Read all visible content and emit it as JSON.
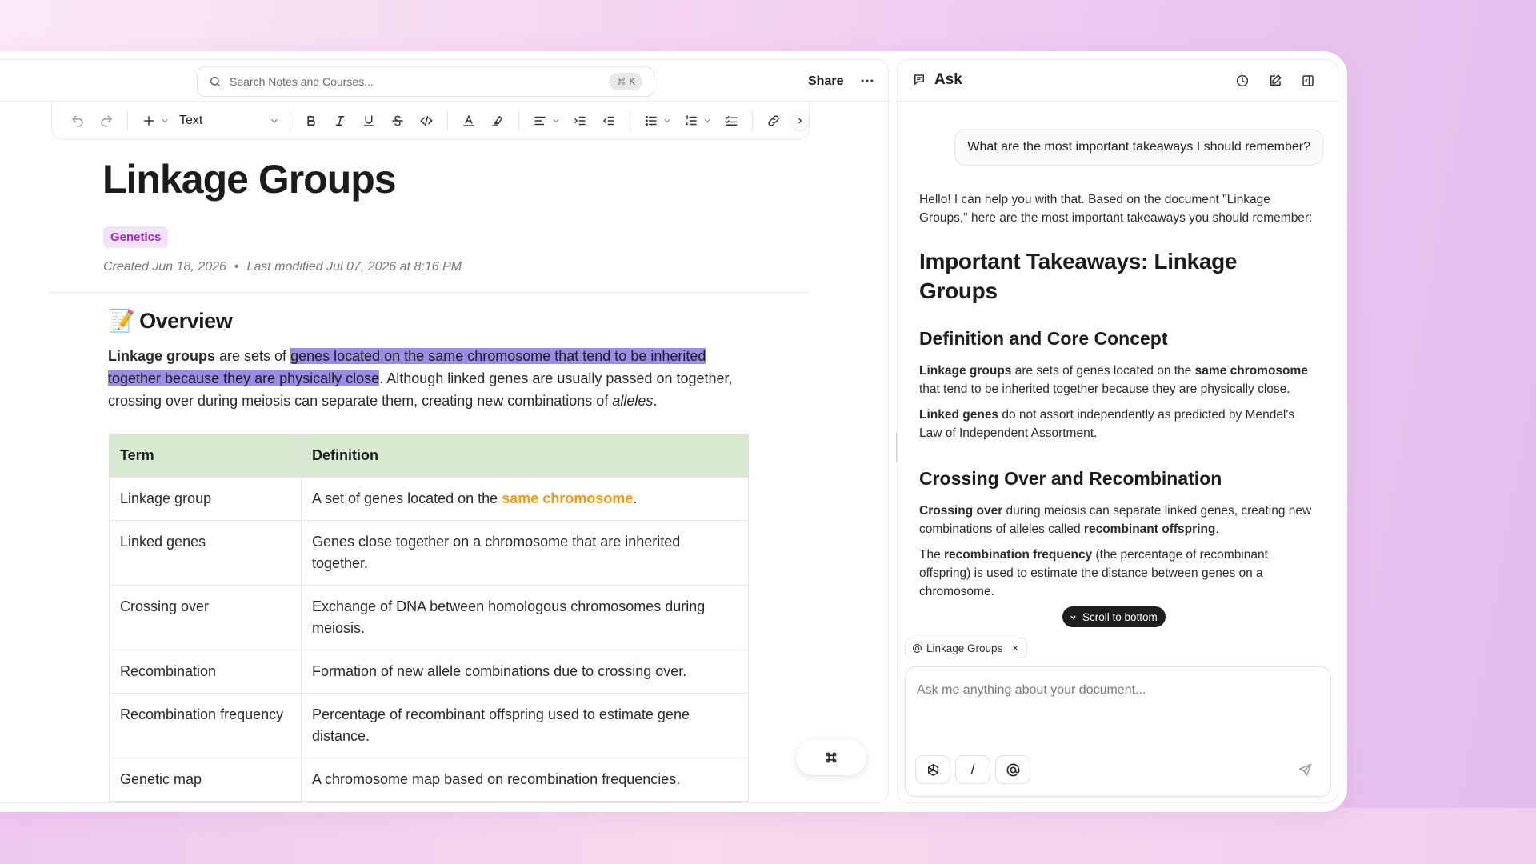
{
  "search": {
    "placeholder": "Search Notes and Courses...",
    "shortcut": "⌘ K"
  },
  "topbar": {
    "share_label": "Share"
  },
  "toolbar": {
    "text_style": "Text"
  },
  "document": {
    "title": "Linkage Groups",
    "tag": "Genetics",
    "created": "Created Jun 18, 2026",
    "separator": "•",
    "modified": "Last modified Jul 07, 2026 at 8:16 PM",
    "overview_emoji": "📝",
    "overview_heading": "Overview",
    "para": {
      "bold": "Linkage groups",
      "t1": " are sets of ",
      "highlight": "genes located on the same chromosome that tend to be inherited together because they are physically close",
      "t2": ". Although linked genes are usually passed on together, crossing over during meiosis can separate them, creating new combinations of ",
      "italic": "alleles",
      "t3": "."
    },
    "table": {
      "headers": [
        "Term",
        "Definition"
      ],
      "rows": [
        {
          "term": "Linkage group",
          "def_pre": "A set of genes located on the ",
          "def_em": "same chromosome",
          "def_post": "."
        },
        {
          "term": "Linked genes",
          "def": "Genes close together on a chromosome that are inherited together."
        },
        {
          "term": "Crossing over",
          "def": "Exchange of DNA between homologous chromosomes during meiosis."
        },
        {
          "term": "Recombination",
          "def": "Formation of new allele combinations due to crossing over."
        },
        {
          "term": "Recombination frequency",
          "def": "Percentage of recombinant offspring used to estimate gene distance."
        },
        {
          "term": "Genetic map",
          "def": "A chromosome map based on recombination frequencies."
        }
      ]
    }
  },
  "ask": {
    "title": "Ask",
    "user_message": "What are the most important takeaways I should remember?",
    "intro": "Hello! I can help you with that. Based on the document \"Linkage Groups,\" here are the most important takeaways you should remember:",
    "h1": "Important Takeaways: Linkage Groups",
    "section1_title": "Definition and Core Concept",
    "s1p1": {
      "b1": "Linkage groups",
      "t1": " are sets of genes located on the ",
      "b2": "same chromosome",
      "t2": " that tend to be inherited together because they are physically close."
    },
    "s1p2": {
      "b1": "Linked genes",
      "t1": " do not assort independently as predicted by Mendel's Law of Independent Assortment."
    },
    "section2_title": "Crossing Over and Recombination",
    "s2p1": {
      "b1": "Crossing over",
      "t1": " during meiosis can separate linked genes, creating new combinations of alleles called ",
      "b2": "recombinant offspring",
      "t2": "."
    },
    "s2p2": {
      "t0": "The ",
      "b1": "recombination frequency",
      "t1": " (the percentage of recombinant offspring) is used to estimate the distance between genes on a chromosome."
    },
    "scroll_label": "Scroll to bottom",
    "context_chip": "Linkage Groups",
    "composer_placeholder": "Ask me anything about your document...",
    "slash_label": "/"
  },
  "colors": {
    "highlight": "#9b8ce8",
    "tag_bg": "#f3e3f8",
    "tag_text": "#9b2bc3",
    "table_header": "#d9ead3",
    "accent_orange": "#f39c12"
  }
}
